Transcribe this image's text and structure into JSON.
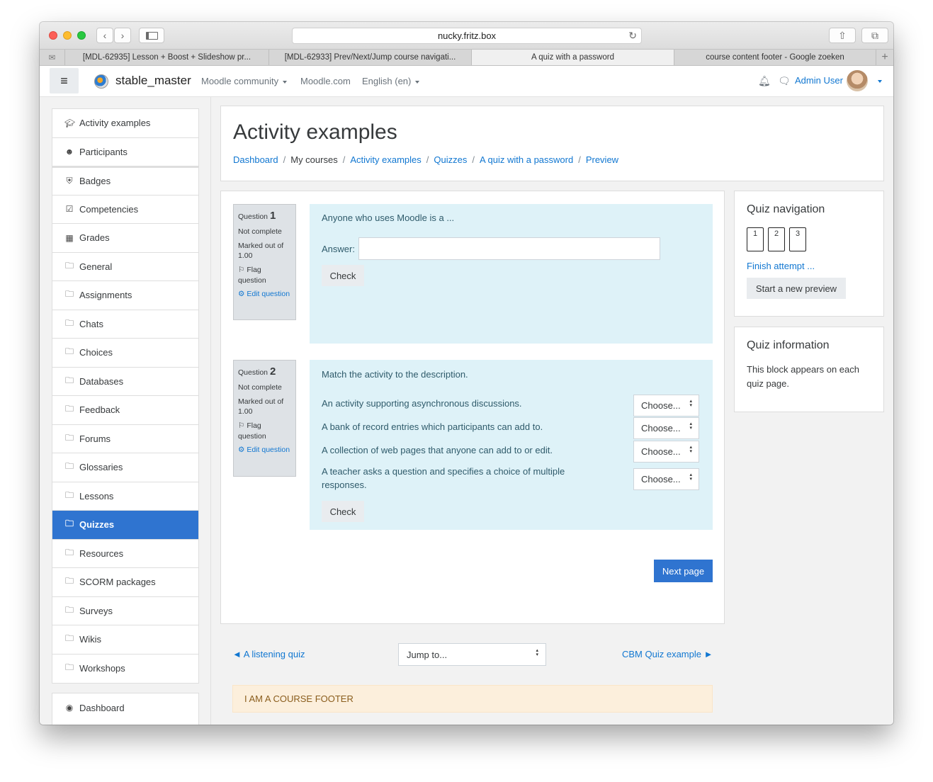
{
  "browser": {
    "url": "nucky.fritz.box",
    "tabs": [
      {
        "label": "[MDL-62935] Lesson + Boost + Slideshow pr..."
      },
      {
        "label": "[MDL-62933] Prev/Next/Jump course navigati..."
      },
      {
        "label": "A quiz with a password"
      },
      {
        "label": "course content footer - Google zoeken"
      }
    ]
  },
  "navbar": {
    "site_name": "stable_master",
    "links": [
      "Moodle community",
      "Moodle.com",
      "English (en)"
    ],
    "user_name": "Admin User"
  },
  "drawer": {
    "items": [
      {
        "label": "Activity examples",
        "icon": "graduation-cap-icon"
      },
      {
        "label": "Participants",
        "icon": "users-icon"
      },
      {
        "label": "Badges",
        "icon": "shield-icon"
      },
      {
        "label": "Competencies",
        "icon": "check-square-icon"
      },
      {
        "label": "Grades",
        "icon": "table-icon"
      },
      {
        "label": "General",
        "icon": "folder-icon"
      },
      {
        "label": "Assignments",
        "icon": "folder-icon"
      },
      {
        "label": "Chats",
        "icon": "folder-icon"
      },
      {
        "label": "Choices",
        "icon": "folder-icon"
      },
      {
        "label": "Databases",
        "icon": "folder-icon"
      },
      {
        "label": "Feedback",
        "icon": "folder-icon"
      },
      {
        "label": "Forums",
        "icon": "folder-icon"
      },
      {
        "label": "Glossaries",
        "icon": "folder-icon"
      },
      {
        "label": "Lessons",
        "icon": "folder-icon"
      },
      {
        "label": "Quizzes",
        "icon": "folder-icon"
      },
      {
        "label": "Resources",
        "icon": "folder-icon"
      },
      {
        "label": "SCORM packages",
        "icon": "folder-icon"
      },
      {
        "label": "Surveys",
        "icon": "folder-icon"
      },
      {
        "label": "Wikis",
        "icon": "folder-icon"
      },
      {
        "label": "Workshops",
        "icon": "folder-icon"
      }
    ],
    "active": "Quizzes",
    "dashboard_label": "Dashboard"
  },
  "header": {
    "title": "Activity examples",
    "breadcrumb": [
      "Dashboard",
      "My courses",
      "Activity examples",
      "Quizzes",
      "A quiz with a password",
      "Preview"
    ]
  },
  "questions": [
    {
      "label": "Question",
      "number": "1",
      "state": "Not complete",
      "marked": "Marked out of 1.00",
      "flag": "Flag question",
      "edit": "Edit question",
      "text": "Anyone who uses Moodle is a ...",
      "answer_label": "Answer:",
      "answer_value": "",
      "check_label": "Check"
    },
    {
      "label": "Question",
      "number": "2",
      "state": "Not complete",
      "marked": "Marked out of 1.00",
      "flag": "Flag question",
      "edit": "Edit question",
      "text": "Match the activity to the description.",
      "rows": [
        {
          "text": "An activity supporting asynchronous discussions.",
          "select": "Choose..."
        },
        {
          "text": "A bank of record entries which participants can add to.",
          "select": "Choose..."
        },
        {
          "text": "A collection of web pages that anyone can add to or edit.",
          "select": "Choose..."
        },
        {
          "text": "A teacher asks a question and specifies a choice of multiple responses.",
          "select": "Choose..."
        }
      ],
      "check_label": "Check"
    }
  ],
  "next_page_label": "Next page",
  "activity_nav": {
    "prev": "◄ A listening quiz",
    "jump": "Jump to...",
    "next": "CBM Quiz example ►"
  },
  "course_footer": "I AM A COURSE FOOTER",
  "quiz_navigation": {
    "title": "Quiz navigation",
    "buttons": [
      "1",
      "2",
      "3"
    ],
    "finish": "Finish attempt ...",
    "new_preview": "Start a new preview"
  },
  "quiz_information": {
    "title": "Quiz information",
    "text": "This block appears on each quiz page."
  },
  "colors": {
    "accent": "#2f74d0",
    "link": "#1177d1",
    "question_bg": "#def2f8",
    "footer_bg": "#fcefdc"
  }
}
